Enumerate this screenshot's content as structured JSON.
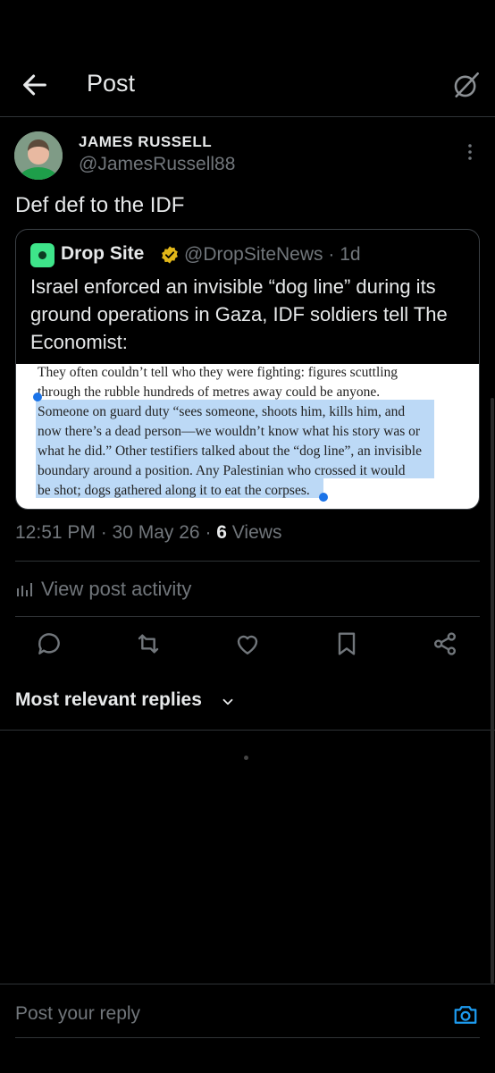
{
  "header": {
    "title": "Post",
    "back_icon": "arrow-left-icon",
    "grok_icon": "grok-icon"
  },
  "post": {
    "author_name": "JAMES RUSSELL",
    "author_handle": "@JamesRussell88",
    "text": "Def def to the IDF",
    "timestamp": "12:51 PM · 30 May 26 · ",
    "views_count": "6",
    "views_label": " Views"
  },
  "quote": {
    "name": "Drop Site",
    "handle": "@DropSiteNews · 1d",
    "text": "Israel enforced an invisible “dog line” during its ground operations in Gaza, IDF soldiers tell The Economist:",
    "image_lines": [
      "They often couldn’t tell who they were fighting: figures scuttling",
      "through the rubble hundreds of metres away could be anyone.",
      "Someone on guard duty “sees someone, shoots him, kills him, and",
      "now there’s a dead person—we wouldn’t know what his story was or",
      "what he did.” Other testifiers talked about the “dog line”, an invisible",
      "boundary around a position. Any Palestinian who crossed it would",
      "be shot; dogs gathered along it to eat the corpses."
    ]
  },
  "activity": {
    "label": "View post activity"
  },
  "actions": [
    "reply-icon",
    "repost-icon",
    "like-icon",
    "bookmark-icon",
    "share-icon"
  ],
  "replies": {
    "sort_label": "Most relevant replies"
  },
  "composer": {
    "placeholder": "Post your reply"
  },
  "colors": {
    "background": "#000000",
    "text": "#e7e9ea",
    "secondary": "#71767b",
    "accent": "#1d9bf0",
    "highlight": "#bcd9f6"
  }
}
